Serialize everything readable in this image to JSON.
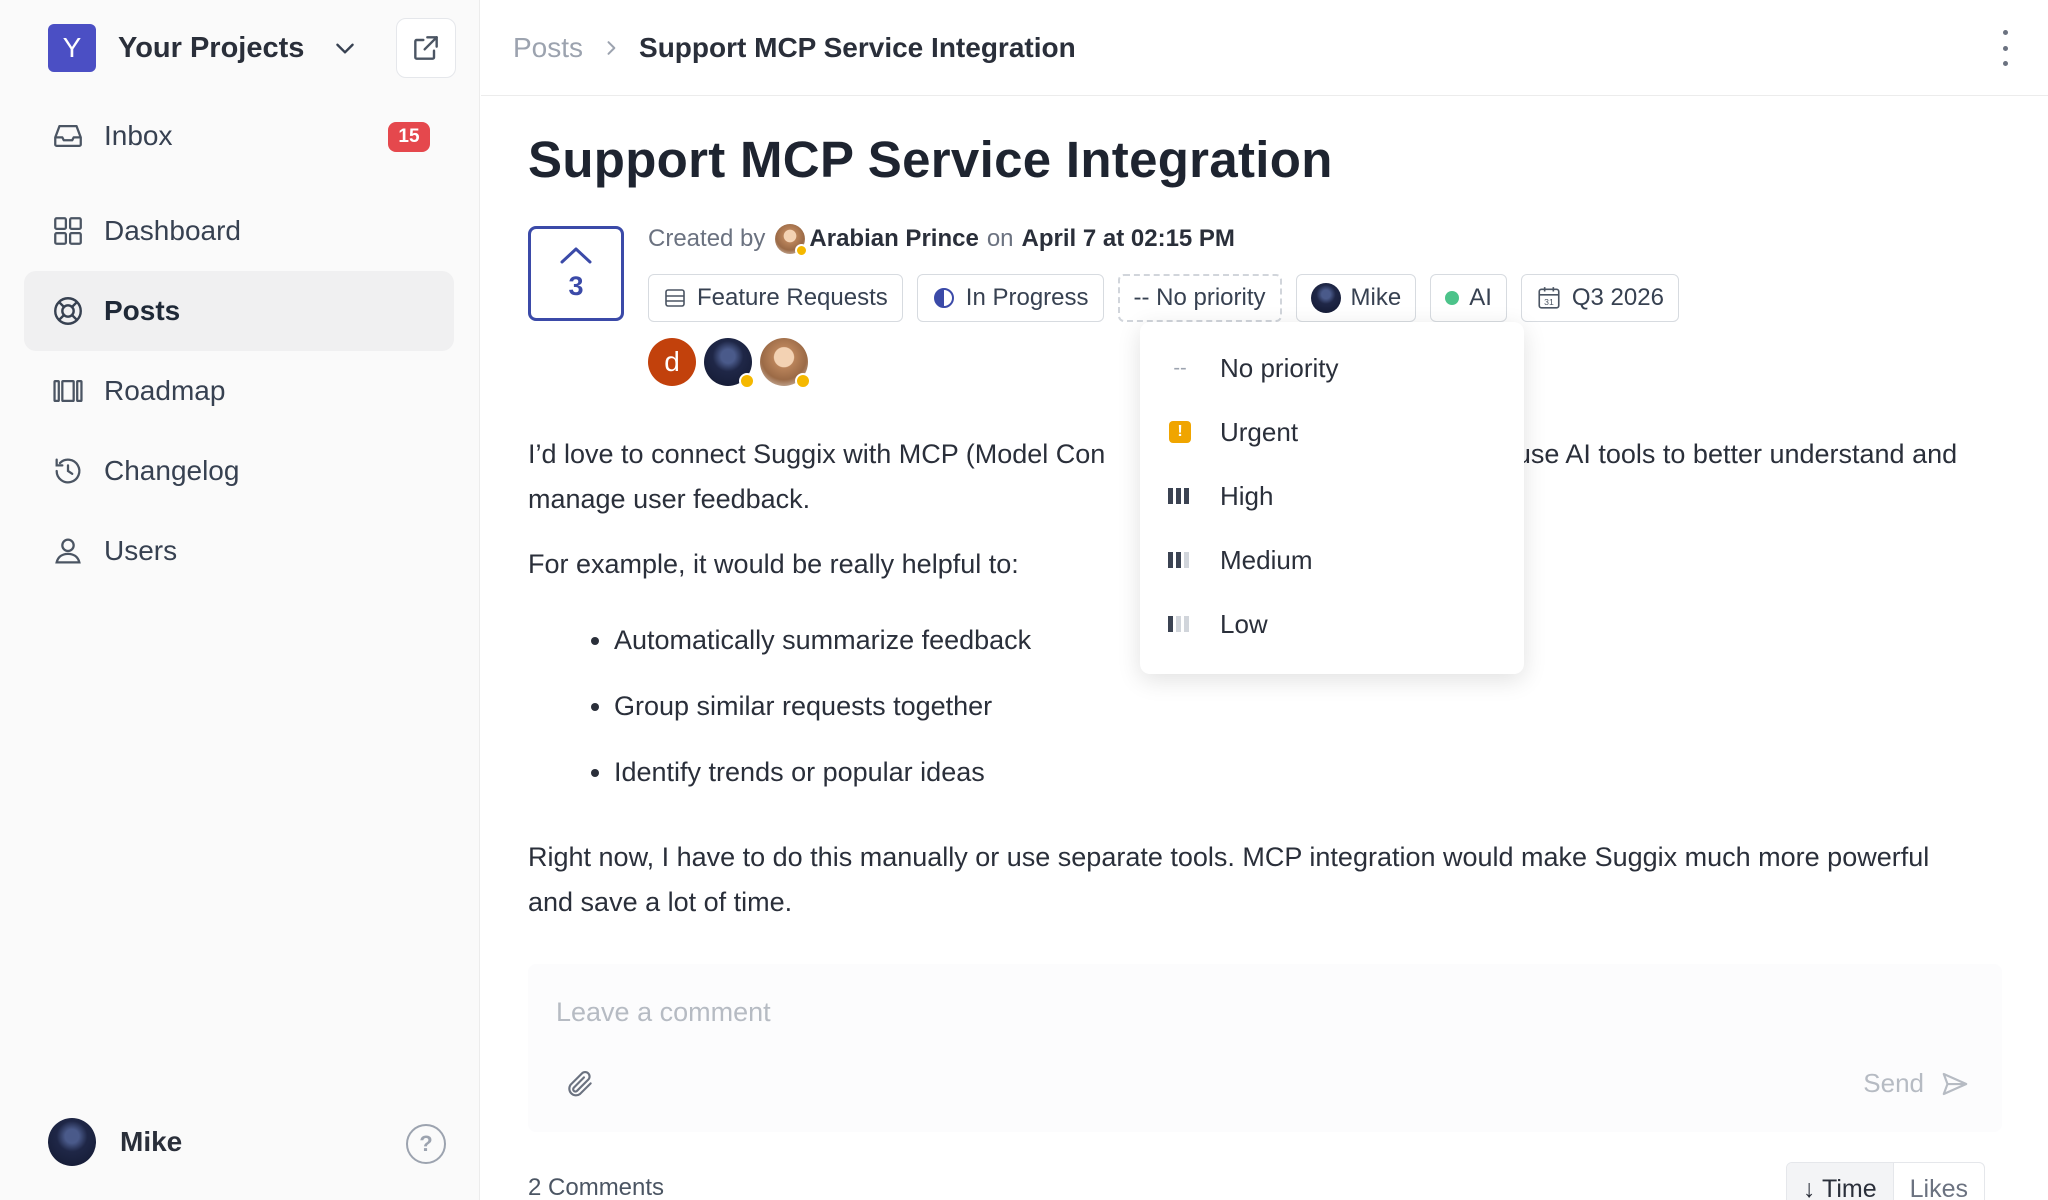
{
  "workspace": {
    "initial": "Y",
    "name": "Your Projects"
  },
  "sidebar": {
    "items": [
      {
        "label": "Inbox",
        "badge": "15"
      },
      {
        "label": "Dashboard"
      },
      {
        "label": "Posts"
      },
      {
        "label": "Roadmap"
      },
      {
        "label": "Changelog"
      },
      {
        "label": "Users"
      }
    ],
    "user": {
      "name": "Mike"
    },
    "help_label": "?"
  },
  "breadcrumb": {
    "parent": "Posts",
    "current": "Support MCP Service Integration"
  },
  "post": {
    "title": "Support MCP Service Integration",
    "votes": "3",
    "meta": {
      "created_by_label": "Created by",
      "author": "Arabian Prince",
      "on_label": "on",
      "date": "April 7 at 02:15 PM"
    },
    "chips": {
      "board": "Feature Requests",
      "status": "In Progress",
      "priority": "-- No priority",
      "assignee": "Mike",
      "tag": "AI",
      "eta": "Q3 2026"
    },
    "watchers": [
      "d"
    ],
    "body": {
      "p1": "I’d love to connect Suggix with MCP (Model Con",
      "p1_tail": "n use AI tools to better understand and manage user feedback.",
      "p2": "For example, it would be really helpful to:",
      "bullets": [
        "Automatically summarize feedback",
        "Group similar requests together",
        "Identify trends or popular ideas"
      ],
      "p3": "Right now, I have to do this manually or use separate tools. MCP integration would make Suggix much more powerful and save a lot of time."
    }
  },
  "priority_menu": {
    "items": [
      {
        "icon": "--",
        "label": "No priority"
      },
      {
        "icon": "!",
        "label": "Urgent"
      },
      {
        "label": "High"
      },
      {
        "label": "Medium"
      },
      {
        "label": "Low"
      }
    ]
  },
  "comment": {
    "placeholder": "Leave a comment",
    "send_label": "Send"
  },
  "comments": {
    "count_label": "2 Comments",
    "sort_time": "↓ Time",
    "sort_likes": "Likes"
  },
  "colors": {
    "accent": "#4b4fc4",
    "badge": "#e5484d",
    "urgent": "#f0a500",
    "tag_dot": "#4cc38a"
  }
}
